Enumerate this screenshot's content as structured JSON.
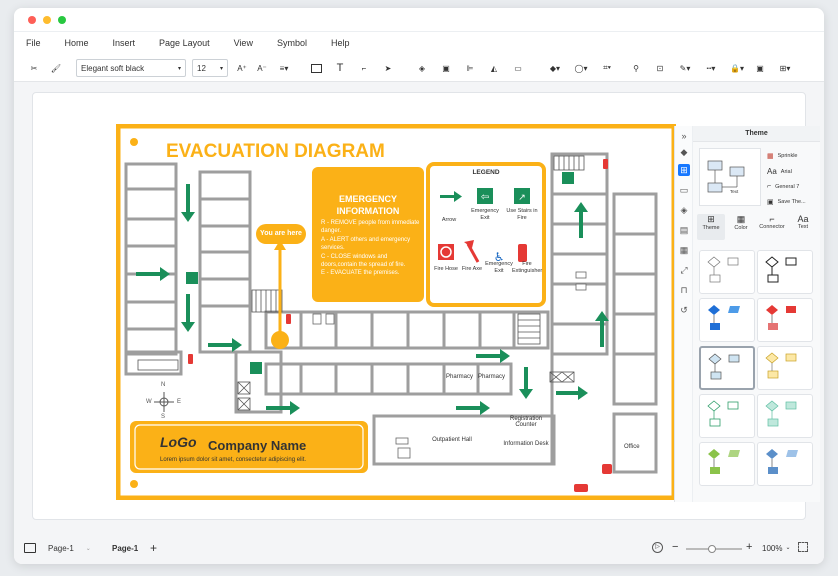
{
  "menu": [
    "File",
    "Home",
    "Insert",
    "Page Layout",
    "View",
    "Symbol",
    "Help"
  ],
  "toolbar": {
    "font": "Elegant soft black",
    "font_size": "12"
  },
  "diagram": {
    "title": "EVACUATION DIAGRAM",
    "you_are_here": "You are here",
    "emergency": {
      "title": "EMERGENCY INFORMATION",
      "lines": [
        "R - REMOVE people from immediate danger.",
        "A - ALERT others and emergency services.",
        "C - CLOSE windows and doors,contain the spread of fire.",
        "E - EVACUATE the premises."
      ]
    },
    "legend": {
      "title": "LEGEND",
      "items": [
        "Arrow",
        "Emergency Exit",
        "Use Stairs in Fire",
        "Fire Hose",
        "Fire Axe",
        "Emergency Exit",
        "Fire Extinguisher"
      ]
    },
    "rooms": {
      "pharmacy1": "Pharmacy",
      "pharmacy2": "Pharmacy",
      "registration": "Registration Counter",
      "information": "Information Desk",
      "outpatient": "Outpatient Hall",
      "office": "Office"
    },
    "company": {
      "logo": "LoGo",
      "name": "Company Name",
      "tagline": "Lorem ipsum dolor sit amet, consectetur adipiscing elit."
    },
    "compass": {
      "n": "N",
      "s": "S",
      "w": "W",
      "e": "E"
    }
  },
  "theme_panel": {
    "title": "Theme",
    "options": [
      "Sprinkle",
      "Arial",
      "General 7",
      "Save The..."
    ],
    "tabs": [
      "Theme",
      "Color",
      "Connector",
      "Text"
    ],
    "preview_labels": [
      "Text",
      "Text"
    ]
  },
  "status": {
    "page_tab": "Page-1",
    "page_active": "Page-1",
    "add": "+",
    "zoom": "100%"
  },
  "colors": {
    "accent": "#fbb117",
    "arrow": "#1a8f5a",
    "wall": "#9e9e9e",
    "red": "#e53935"
  }
}
